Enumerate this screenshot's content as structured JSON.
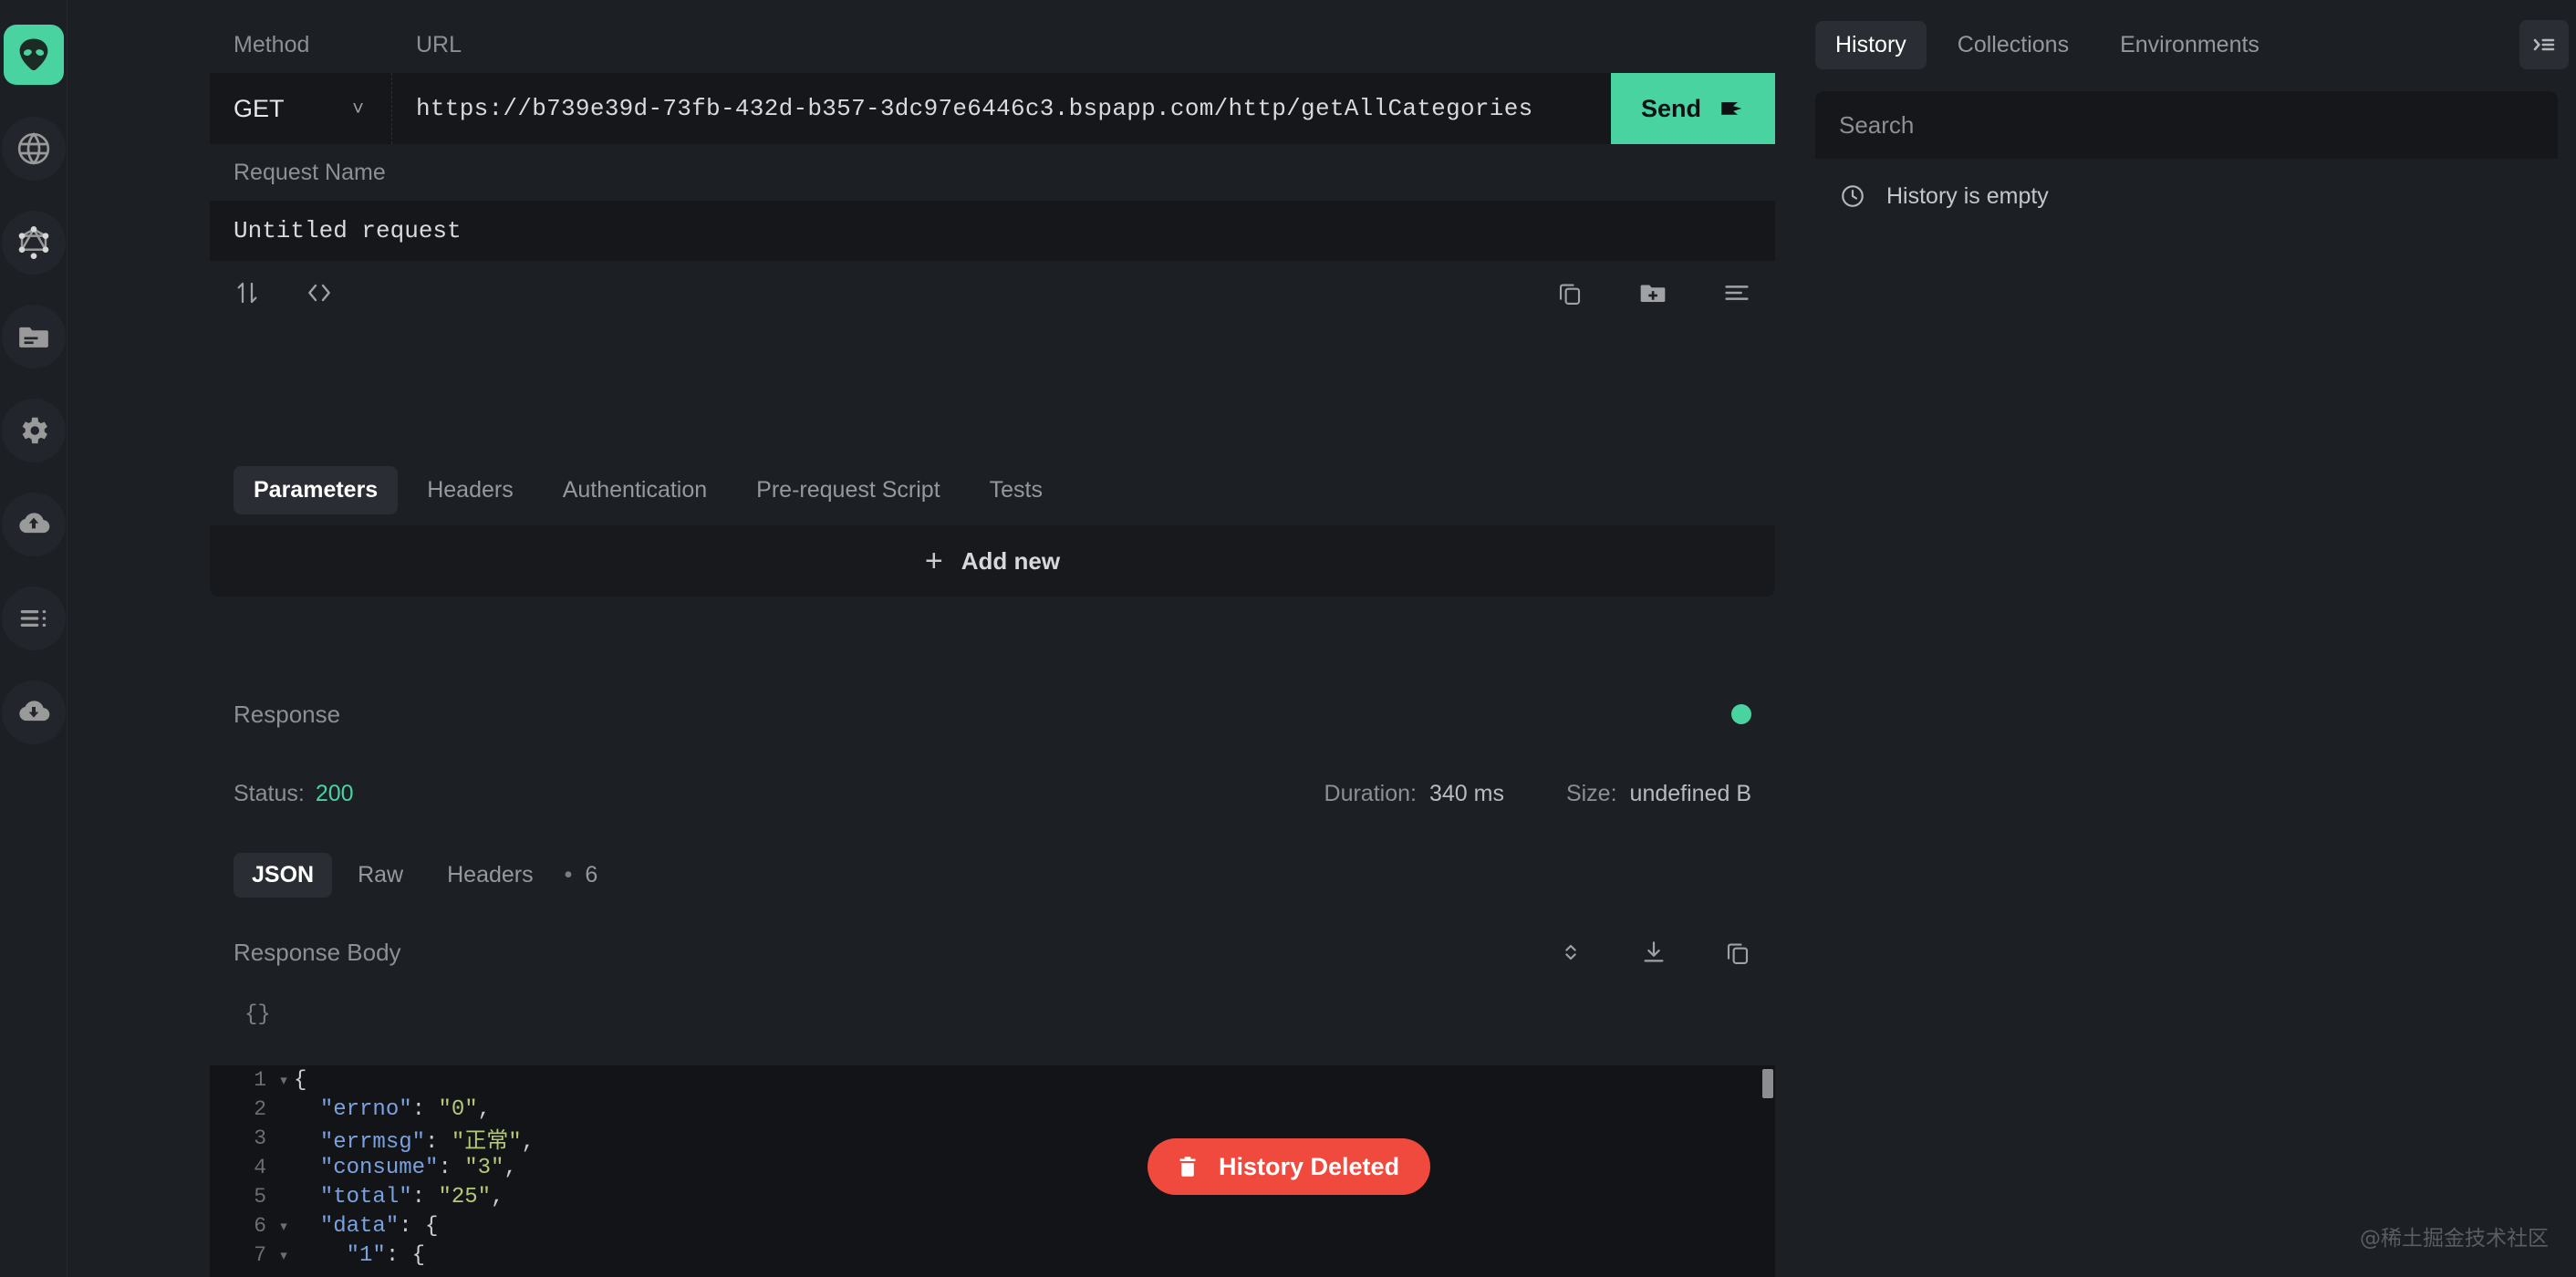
{
  "rail": {
    "items": [
      {
        "name": "logo",
        "icon": "alien-logo-icon",
        "active": true
      },
      {
        "name": "rest",
        "icon": "globe-icon",
        "active": false
      },
      {
        "name": "graphql",
        "icon": "graphql-icon",
        "active": false
      },
      {
        "name": "realtime",
        "icon": "folder-icon",
        "active": false
      },
      {
        "name": "settings",
        "icon": "gear-icon",
        "active": false
      },
      {
        "name": "upload",
        "icon": "cloud-upload-icon",
        "active": false
      },
      {
        "name": "list",
        "icon": "list-icon",
        "active": false
      },
      {
        "name": "download",
        "icon": "cloud-download-icon",
        "active": false
      }
    ]
  },
  "request": {
    "method_label": "Method",
    "url_label": "URL",
    "method_value": "GET",
    "url_value": "https://b739e39d-73fb-432d-b357-3dc97e6446c3.bspapp.com/http/getAllCategories",
    "send_label": "Send",
    "name_label": "Request Name",
    "name_value": "Untitled request",
    "toolbar": {
      "save_icon": "sort-updown-icon",
      "code_icon": "code-brackets-icon",
      "copy_icon": "copy-icon",
      "new_folder_icon": "folder-plus-icon",
      "menu_icon": "align-left-icon"
    }
  },
  "params": {
    "tabs": [
      {
        "label": "Parameters",
        "active": true
      },
      {
        "label": "Headers",
        "active": false
      },
      {
        "label": "Authentication",
        "active": false
      },
      {
        "label": "Pre-request Script",
        "active": false
      },
      {
        "label": "Tests",
        "active": false
      }
    ],
    "add_new_label": "Add new",
    "plus": "+"
  },
  "response": {
    "title": "Response",
    "status_label": "Status:",
    "status_value": "200",
    "duration_label": "Duration:",
    "duration_value": "340 ms",
    "size_label": "Size:",
    "size_value": "undefined B",
    "tabs": [
      {
        "label": "JSON",
        "active": true
      },
      {
        "label": "Raw",
        "active": false
      },
      {
        "label": "Headers",
        "active": false
      }
    ],
    "headers_separator": "•",
    "headers_count": "6",
    "body_title": "Response Body",
    "json_chip": "{}",
    "body_icons": {
      "expand_icon": "chevron-updown-icon",
      "download_icon": "download-icon",
      "copy_icon": "copy-icon"
    },
    "accent_color": "#49d3a0",
    "code_lines": [
      {
        "num": "1",
        "fold": true,
        "indent": 0,
        "tokens": [
          {
            "t": "p",
            "v": "{"
          }
        ]
      },
      {
        "num": "2",
        "fold": false,
        "indent": 1,
        "tokens": [
          {
            "t": "k",
            "v": "\"errno\""
          },
          {
            "t": "p",
            "v": ": "
          },
          {
            "t": "s",
            "v": "\"0\""
          },
          {
            "t": "p",
            "v": ","
          }
        ]
      },
      {
        "num": "3",
        "fold": false,
        "indent": 1,
        "tokens": [
          {
            "t": "k",
            "v": "\"errmsg\""
          },
          {
            "t": "p",
            "v": ": "
          },
          {
            "t": "s",
            "v": "\"正常\""
          },
          {
            "t": "p",
            "v": ","
          }
        ]
      },
      {
        "num": "4",
        "fold": false,
        "indent": 1,
        "tokens": [
          {
            "t": "k",
            "v": "\"consume\""
          },
          {
            "t": "p",
            "v": ": "
          },
          {
            "t": "s",
            "v": "\"3\""
          },
          {
            "t": "p",
            "v": ","
          }
        ]
      },
      {
        "num": "5",
        "fold": false,
        "indent": 1,
        "tokens": [
          {
            "t": "k",
            "v": "\"total\""
          },
          {
            "t": "p",
            "v": ": "
          },
          {
            "t": "s",
            "v": "\"25\""
          },
          {
            "t": "p",
            "v": ","
          }
        ]
      },
      {
        "num": "6",
        "fold": true,
        "indent": 1,
        "tokens": [
          {
            "t": "k",
            "v": "\"data\""
          },
          {
            "t": "p",
            "v": ": {"
          }
        ]
      },
      {
        "num": "7",
        "fold": true,
        "indent": 2,
        "tokens": [
          {
            "t": "k",
            "v": "\"1\""
          },
          {
            "t": "p",
            "v": ": {"
          }
        ]
      }
    ]
  },
  "side": {
    "tabs": [
      {
        "label": "History",
        "active": true
      },
      {
        "label": "Collections",
        "active": false
      },
      {
        "label": "Environments",
        "active": false
      }
    ],
    "collapse_icon": "panel-collapse-icon",
    "search_placeholder": "Search",
    "empty_label": "History is empty",
    "clock_icon": "clock-icon"
  },
  "toast": {
    "label": "History Deleted",
    "icon": "trash-icon",
    "color": "#ef4a3d"
  },
  "watermark": "@稀土掘金技术社区"
}
